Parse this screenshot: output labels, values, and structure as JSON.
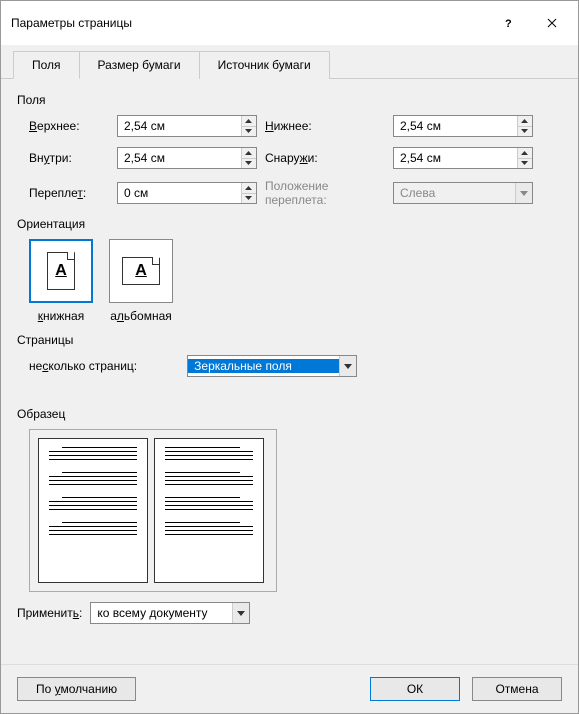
{
  "title": "Параметры страницы",
  "tabs": [
    "Поля",
    "Размер бумаги",
    "Источник бумаги"
  ],
  "margins": {
    "group": "Поля",
    "top_label_pre": "",
    "top_label_u": "В",
    "top_label_post": "ерхнее:",
    "bottom_label_pre": "",
    "bottom_label_u": "Н",
    "bottom_label_post": "ижнее:",
    "inside_label_pre": "Вн",
    "inside_label_u": "у",
    "inside_label_post": "три:",
    "outside_label_pre": "Снару",
    "outside_label_u": "ж",
    "outside_label_post": "и:",
    "gutter_label_pre": "Перепле",
    "gutter_label_u": "т",
    "gutter_label_post": ":",
    "gutterpos_label": "Положение переплета:",
    "top": "2,54 см",
    "bottom": "2,54 см",
    "inside": "2,54 см",
    "outside": "2,54 см",
    "gutter": "0 см",
    "gutter_pos": "Слева"
  },
  "orientation": {
    "group": "Ориентация",
    "portrait_pre": "",
    "portrait_u": "к",
    "portrait_post": "нижная",
    "landscape_pre": "а",
    "landscape_u": "л",
    "landscape_post": "ьбомная",
    "letter": "А"
  },
  "pages": {
    "group": "Страницы",
    "label_pre": "не",
    "label_u": "с",
    "label_post": "колько страниц:",
    "value": "Зеркальные поля"
  },
  "preview": {
    "group": "Образец"
  },
  "apply": {
    "label_pre": "Применит",
    "label_u": "ь",
    "label_post": ":",
    "value": "ко всему документу"
  },
  "buttons": {
    "default_pre": "По ",
    "default_u": "у",
    "default_post": "молчанию",
    "ok": "ОК",
    "cancel": "Отмена"
  }
}
